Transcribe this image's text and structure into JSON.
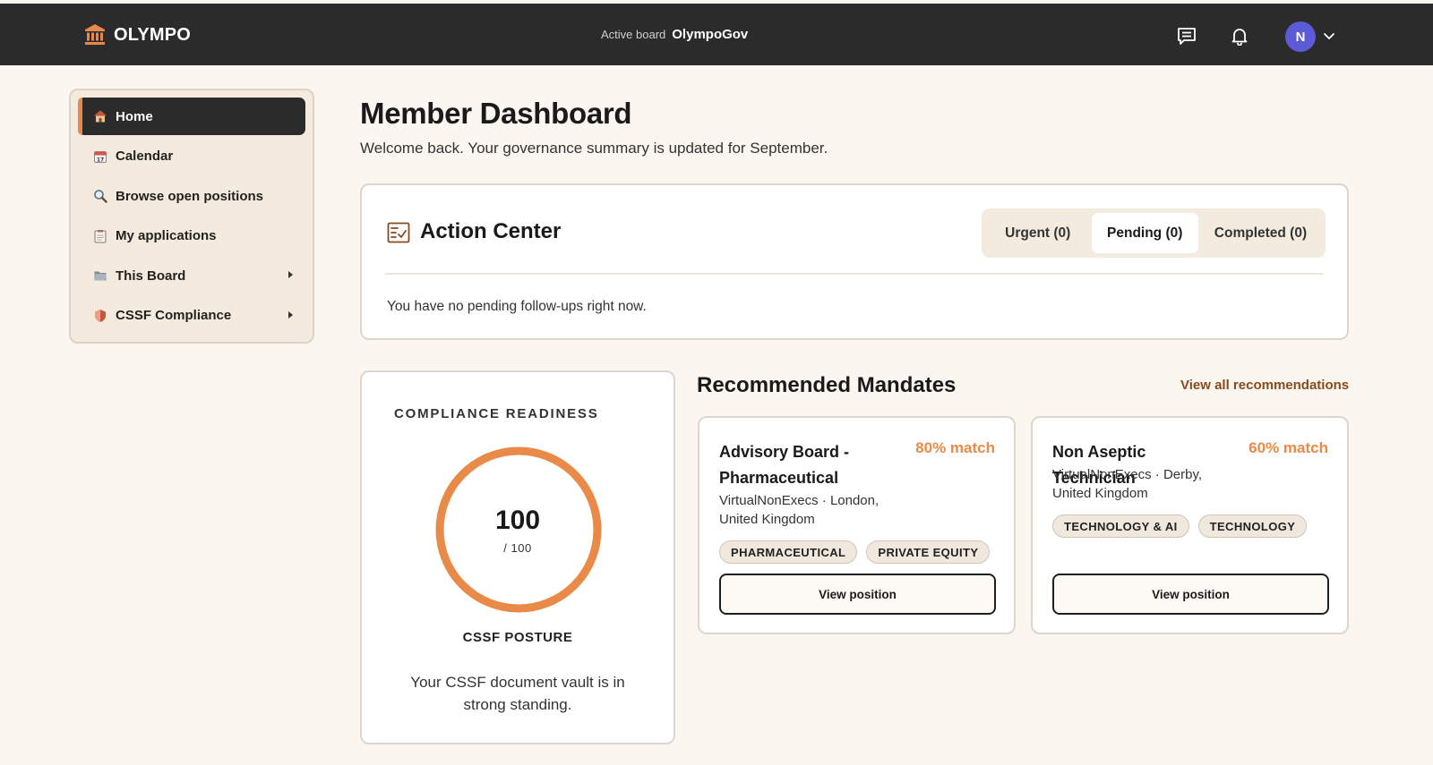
{
  "app": {
    "name": "OLYMPO",
    "active_board_label": "Active board",
    "active_board_value": "OlympoGov",
    "avatar_initial": "N"
  },
  "icons": {
    "logo": "building-columns-icon",
    "messages": "message-icon",
    "notifications": "bell-icon",
    "user_menu": "chevron-down-icon"
  },
  "sidebar": {
    "items": [
      {
        "label": "Home",
        "icon": "house-icon",
        "active": true
      },
      {
        "label": "Calendar",
        "icon": "calendar-icon"
      },
      {
        "label": "Browse open positions",
        "icon": "magnifier-icon"
      },
      {
        "label": "My applications",
        "icon": "clipboard-icon"
      },
      {
        "label": "This Board",
        "icon": "folder-icon",
        "expandable": true
      },
      {
        "label": "CSSF Compliance",
        "icon": "shield-icon",
        "expandable": true
      }
    ]
  },
  "main": {
    "title": "Member Dashboard",
    "subtitle": "Welcome back. Your governance summary is updated for September."
  },
  "action_center": {
    "title": "Action Center",
    "tabs": [
      {
        "label": "Urgent (0)"
      },
      {
        "label": "Pending (0)",
        "selected": true
      },
      {
        "label": "Completed (0)"
      }
    ],
    "empty_message": "You have no pending follow-ups right now."
  },
  "compliance": {
    "heading": "COMPLIANCE READINESS",
    "score": "100",
    "score_max": "/ 100",
    "score_fraction": 1.0,
    "posture_label": "CSSF POSTURE",
    "description": "Your CSSF document vault is in strong standing."
  },
  "recommended": {
    "title": "Recommended Mandates",
    "view_all": "View all recommendations",
    "mandates": [
      {
        "title": "Advisory Board - Pharmaceutical",
        "match": "80% match",
        "meta": "VirtualNonExecs · London, United Kingdom",
        "tags": [
          "PHARMACEUTICAL",
          "PRIVATE EQUITY"
        ],
        "button": "View position"
      },
      {
        "title": "Non Aseptic Technician",
        "match": "60% match",
        "meta": "VirtualNonExecs · Derby, United Kingdom",
        "tags": [
          "TECHNOLOGY & AI",
          "TECHNOLOGY"
        ],
        "button": "View position"
      }
    ]
  },
  "colors": {
    "topbar": "#2b2b2b",
    "accent": "#e8894b",
    "avatar": "#5b5bd6",
    "link": "#8a4a1c",
    "background": "#fbf6f0"
  }
}
